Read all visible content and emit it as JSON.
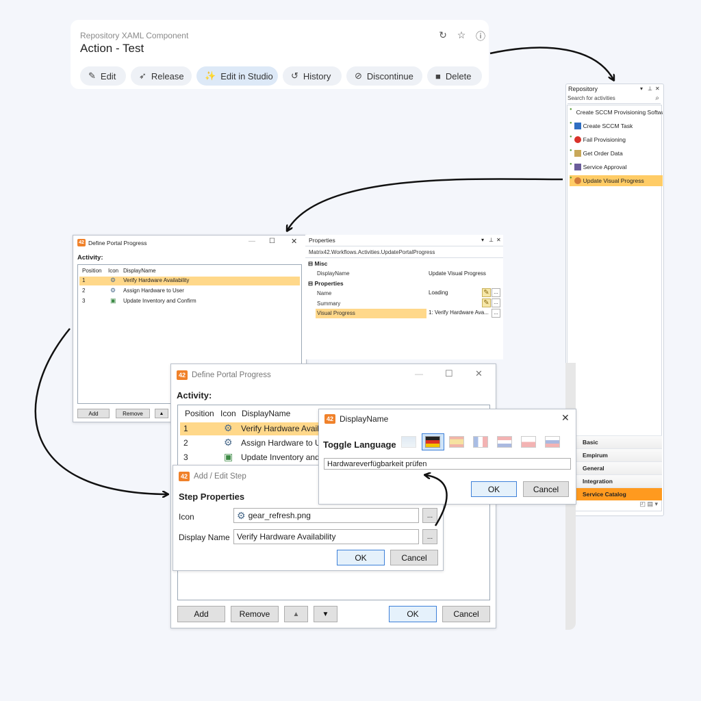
{
  "portal_card": {
    "subtitle": "Repository XAML Component",
    "title": "Action - Test",
    "actions": [
      {
        "label": "Edit",
        "icon": "pencil-icon"
      },
      {
        "label": "Release",
        "icon": "rocket-icon"
      },
      {
        "label": "Edit in Studio",
        "icon": "magic-wand-icon"
      },
      {
        "label": "History",
        "icon": "history-icon"
      },
      {
        "label": "Discontinue",
        "icon": "block-icon"
      },
      {
        "label": "Delete",
        "icon": "trash-icon"
      }
    ]
  },
  "repository": {
    "title": "Repository",
    "search_placeholder": "Search for activities",
    "items": [
      {
        "label": "Create SCCM Provisioning Software"
      },
      {
        "label": "Create SCCM Task"
      },
      {
        "label": "Fail Provisioning"
      },
      {
        "label": "Get Order Data"
      },
      {
        "label": "Service Approval"
      },
      {
        "label": "Update Visual Progress"
      }
    ],
    "categories": [
      "Basic",
      "Empirum",
      "General",
      "Integration",
      "Service Catalog"
    ]
  },
  "define_small": {
    "title": "Define Portal Progress",
    "activity_label": "Activity:",
    "columns": [
      "Position",
      "Icon",
      "DisplayName"
    ],
    "rows": [
      {
        "position": "1",
        "name": "Verify Hardware Availability"
      },
      {
        "position": "2",
        "name": "Assign Hardware to User"
      },
      {
        "position": "3",
        "name": "Update Inventory and Confirm"
      }
    ],
    "add": "Add",
    "remove": "Remove"
  },
  "properties": {
    "title": "Properties",
    "class_name": "Matrix42.Workflows.Activities.UpdatePortalProgress",
    "misc_label": "Misc",
    "display_name_key": "DisplayName",
    "display_name_val": "Update Visual Progress",
    "properties_label": "Properties",
    "name_key": "Name",
    "name_val": "Loading",
    "summary_key": "Summary",
    "visual_key": "Visual Progress",
    "visual_val": "1: Verify Hardware Ava..."
  },
  "define_large": {
    "title": "Define Portal Progress",
    "activity_label": "Activity:",
    "columns": [
      "Position",
      "Icon",
      "DisplayName"
    ],
    "rows": [
      {
        "position": "1",
        "name": "Verify Hardware Availa"
      },
      {
        "position": "2",
        "name": "Assign Hardware to Us"
      },
      {
        "position": "3",
        "name": "Update Inventory and"
      }
    ],
    "add": "Add",
    "remove": "Remove",
    "ok": "OK",
    "cancel": "Cancel"
  },
  "add_edit": {
    "title": "Add / Edit Step",
    "section": "Step Properties",
    "icon_label": "Icon",
    "icon_value": "gear_refresh.png",
    "display_label": "Display Name",
    "display_value": "Verify Hardware Availability",
    "ok": "OK",
    "cancel": "Cancel",
    "browse": "..."
  },
  "display_dialog": {
    "title": "DisplayName",
    "toggle_label": "Toggle Language",
    "value": "Hardwareverfügbarkeit prüfen",
    "ok": "OK",
    "cancel": "Cancel"
  },
  "logo_text": "42",
  "colors": {
    "accent_orange": "#f0812a",
    "selection_yellow": "#ffd88a",
    "category_selected": "#ff9a1f",
    "primary_button_border": "#3c7fd8"
  }
}
